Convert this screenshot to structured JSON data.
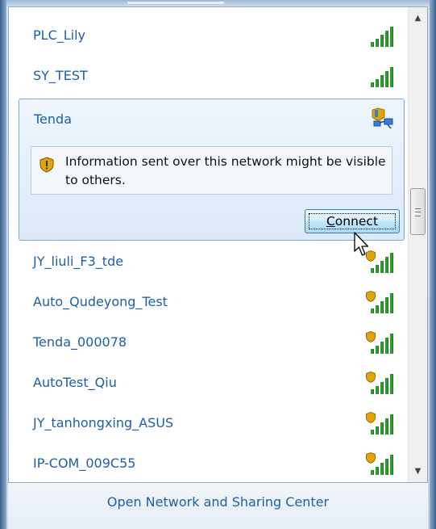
{
  "networks_above": [
    {
      "name": "PLC_Lily",
      "secured": false
    },
    {
      "name": "SY_TEST",
      "secured": false
    }
  ],
  "selected_network": {
    "name": "Tenda",
    "warning": "Information sent over this network might be visible to others.",
    "connect_label_first": "C",
    "connect_label_rest": "onnect"
  },
  "networks_below": [
    {
      "name": "JY_liuli_F3_tde",
      "secured": true
    },
    {
      "name": "Auto_Qudeyong_Test",
      "secured": true
    },
    {
      "name": "Tenda_000078",
      "secured": true
    },
    {
      "name": "AutoTest_Qiu",
      "secured": true
    },
    {
      "name": "JY_tanhongxing_ASUS",
      "secured": true
    },
    {
      "name": "IP-COM_009C55",
      "secured": true
    }
  ],
  "footer": {
    "link": "Open Network and Sharing Center"
  },
  "colors": {
    "link": "#1e5fa8",
    "signal": "#2f9c2f",
    "shield": "#e3a300"
  },
  "icons": {
    "signal": "signal-strength-icon",
    "shield": "security-shield-icon",
    "warning": "warning-shield-icon",
    "network": "network-icon",
    "cursor": "mouse-cursor-icon"
  }
}
